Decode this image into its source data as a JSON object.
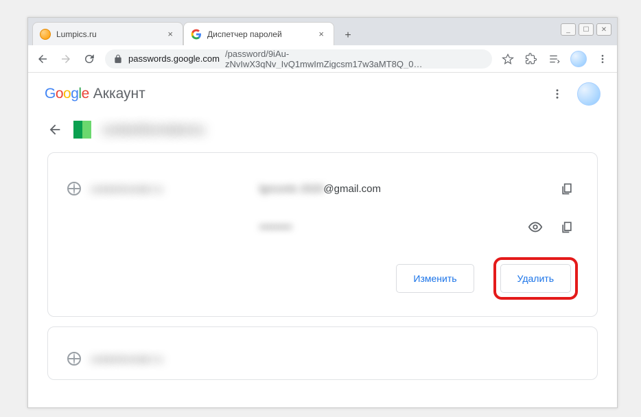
{
  "window": {
    "minimize": "_",
    "maximize": "☐",
    "close": "✕"
  },
  "tabs": [
    {
      "title": "Lumpics.ru"
    },
    {
      "title": "Диспетчер паролей"
    }
  ],
  "address": {
    "lock": "lock",
    "host": "passwords.google.com",
    "path": "/password/9iAu-zNvIwX3qNv_IvQ1mwImZigcsm17w3aMT8Q_0…"
  },
  "app": {
    "brand": "Google",
    "account_word": "Аккаунт"
  },
  "page": {
    "site_name_blurred": "contenthomstercru"
  },
  "entry": {
    "site_blurred": "contentmonster ru",
    "email_blurred": "lgncontc 2020",
    "email_clear": "@gmail.com",
    "password_blurred": "•••••••••"
  },
  "actions": {
    "edit": "Изменить",
    "delete": "Удалить"
  },
  "second_card": {
    "site": "contentmonster ru"
  }
}
